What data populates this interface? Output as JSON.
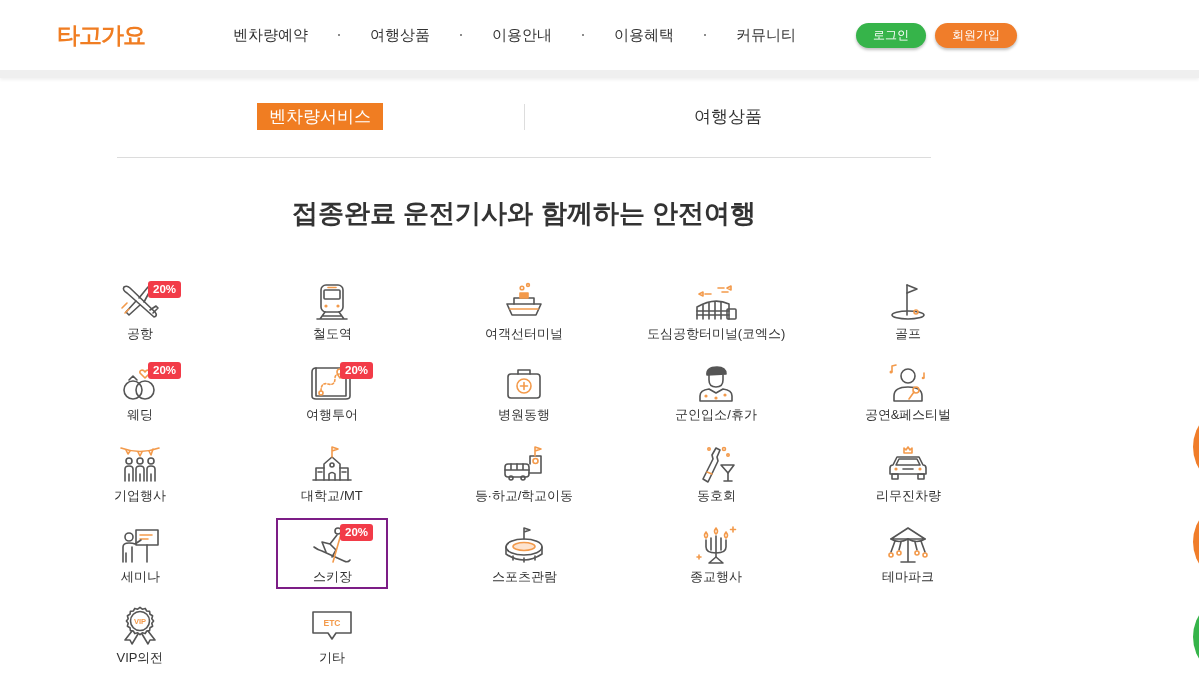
{
  "header": {
    "logo": "타고가요",
    "nav": [
      "벤차량예약",
      "여행상품",
      "이용안내",
      "이용혜택",
      "커뮤니티"
    ],
    "buttons": [
      {
        "kind": "login",
        "label": "로그인"
      },
      {
        "kind": "signup",
        "label": "회원가입"
      }
    ]
  },
  "tabs": [
    {
      "label": "벤차량서비스",
      "selected": true
    },
    {
      "label": "여행상품",
      "selected": false
    }
  ],
  "title": "접종완료 운전기사와 함께하는 안전여행",
  "services": [
    {
      "label": "공항",
      "badge": "20%",
      "selected": false
    },
    {
      "label": "철도역",
      "selected": false
    },
    {
      "label": "여객선터미널",
      "selected": false
    },
    {
      "label": "도심공항터미널(코엑스)",
      "selected": false
    },
    {
      "label": "골프",
      "selected": false
    },
    {
      "label": "웨딩",
      "badge": "20%",
      "selected": false
    },
    {
      "label": "여행투어",
      "badge": "20%",
      "selected": false
    },
    {
      "label": "병원동행",
      "selected": false
    },
    {
      "label": "군인입소/휴가",
      "selected": false
    },
    {
      "label": "공연&페스티벌",
      "selected": false
    },
    {
      "label": "기업행사",
      "selected": false
    },
    {
      "label": "대학교/MT",
      "selected": false
    },
    {
      "label": "등·하교/학교이동",
      "selected": false
    },
    {
      "label": "동호회",
      "selected": false
    },
    {
      "label": "리무진차량",
      "selected": false
    },
    {
      "label": "세미나",
      "selected": false
    },
    {
      "label": "스키장",
      "badge": "20%",
      "selected": true
    },
    {
      "label": "스포츠관람",
      "selected": false
    },
    {
      "label": "종교행사",
      "selected": false
    },
    {
      "label": "테마파크",
      "selected": false
    },
    {
      "label": "VIP의전",
      "icon_text": "VIP",
      "selected": false
    },
    {
      "label": "기타",
      "icon_text": "ETC",
      "selected": false
    }
  ],
  "floating_buttons": [
    {
      "color": "#f07d2a"
    },
    {
      "color": "#f07d2a"
    },
    {
      "color": "#36b44a"
    }
  ]
}
